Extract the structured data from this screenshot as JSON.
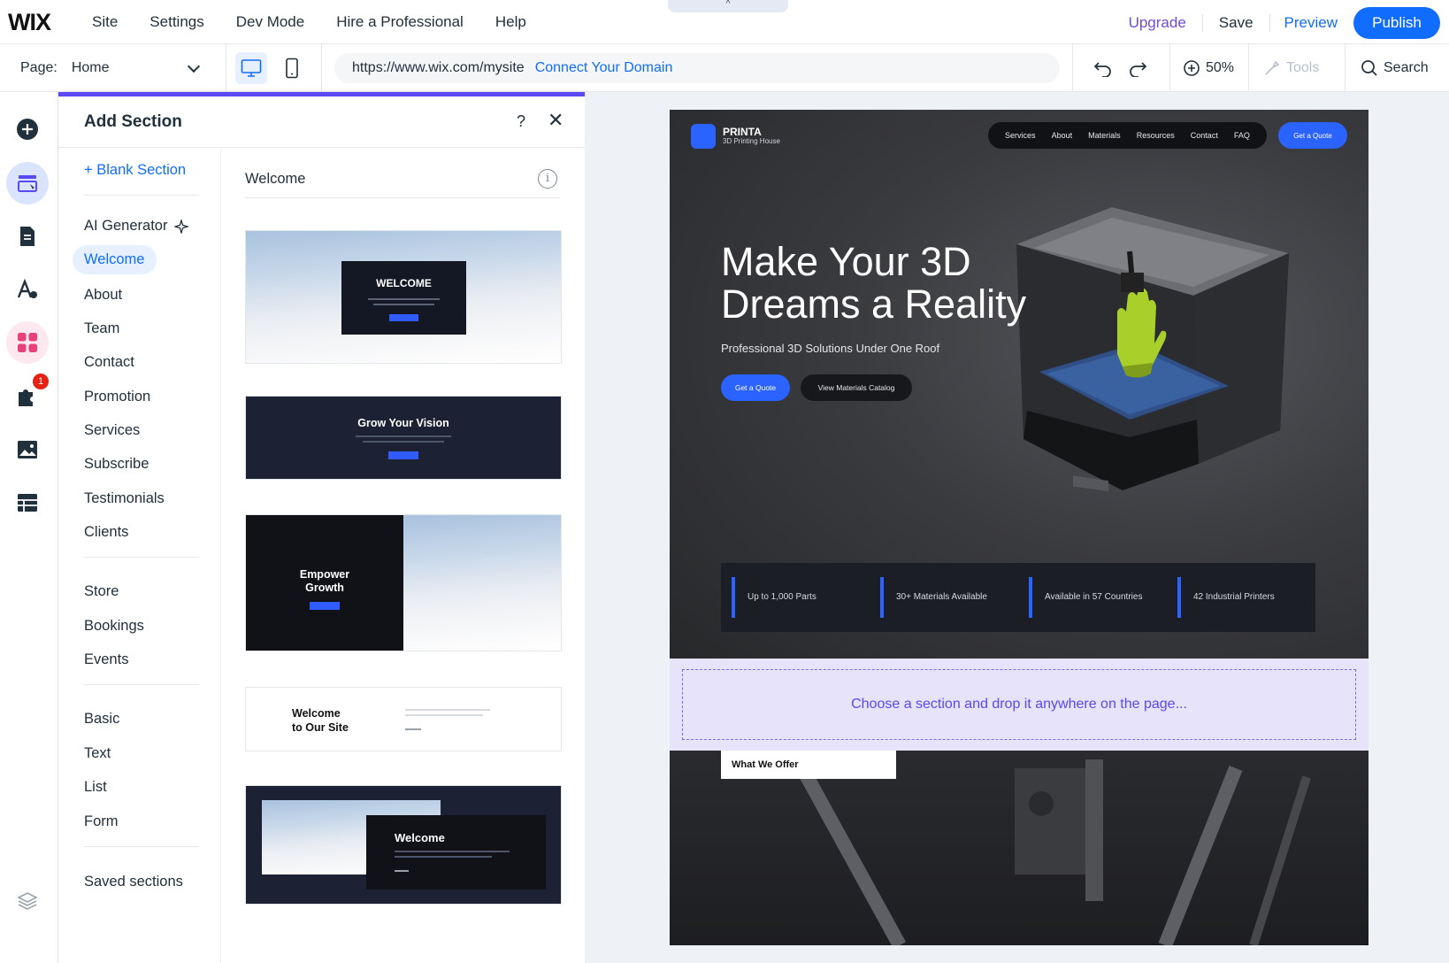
{
  "app": {
    "logo": "WIX",
    "menu": [
      "Site",
      "Settings",
      "Dev Mode",
      "Hire a Professional",
      "Help"
    ],
    "upgrade": "Upgrade",
    "save": "Save",
    "preview": "Preview",
    "publish": "Publish",
    "collapse_glyph": "^"
  },
  "toolbar": {
    "page_label": "Page:",
    "page_value": "Home",
    "url": "https://www.wix.com/mysite",
    "connect_domain": "Connect Your Domain",
    "zoom": "50%",
    "tools": "Tools",
    "search": "Search"
  },
  "rail": {
    "apps_badge": "1"
  },
  "panel": {
    "title": "Add Section",
    "help": "?",
    "close": "✕",
    "blank_section": "+ Blank Section",
    "ai_generator": "AI Generator",
    "categories": [
      "Welcome",
      "About",
      "Team",
      "Contact",
      "Promotion",
      "Services",
      "Subscribe",
      "Testimonials",
      "Clients"
    ],
    "commerce": [
      "Store",
      "Bookings",
      "Events"
    ],
    "basics": [
      "Basic",
      "Text",
      "List",
      "Form"
    ],
    "saved": "Saved sections",
    "content_title": "Welcome",
    "info": "i",
    "thumbs": {
      "t1": "WELCOME",
      "t2": "Grow Your Vision",
      "t3_line1": "Empower",
      "t3_line2": "Growth",
      "t4_line1": "Welcome",
      "t4_line2": "to Our Site",
      "t5": "Welcome"
    }
  },
  "site": {
    "brand": "PRINTA",
    "brand_sub": "3D Printing House",
    "nav": [
      "Services",
      "About",
      "Materials",
      "Resources",
      "Contact",
      "FAQ"
    ],
    "cta": "Get a Quote",
    "headline": "Make Your 3D Dreams a Reality",
    "subhead": "Professional 3D Solutions Under One Roof",
    "btn_quote": "Get a Quote",
    "btn_catalog": "View Materials Catalog",
    "stats": [
      "Up to 1,000 Parts",
      "30+ Materials Available",
      "Available in 57 Countries",
      "42 Industrial Printers"
    ],
    "drop_hint": "Choose a section and drop it anywhere on the page...",
    "offer": "What We Offer"
  },
  "colors": {
    "accent": "#116dff",
    "panel_accent": "#5a48f5",
    "upgrade": "#6f4bd8",
    "site_blue": "#2a63ff"
  }
}
